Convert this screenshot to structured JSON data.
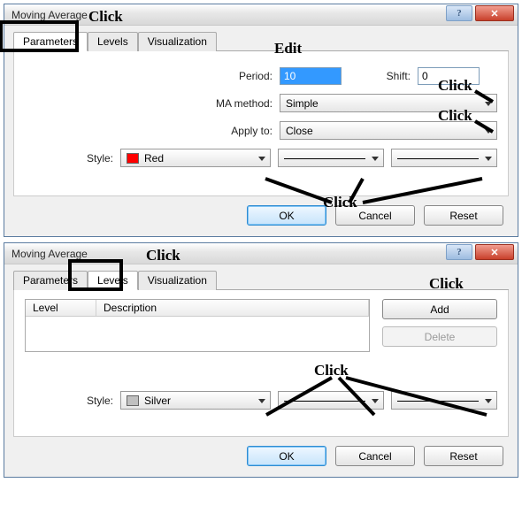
{
  "dialog1": {
    "title": "Moving Average",
    "tabs": {
      "parameters": "Parameters",
      "levels": "Levels",
      "visualization": "Visualization"
    },
    "period_label": "Period:",
    "period_value": "10",
    "shift_label": "Shift:",
    "shift_value": "0",
    "ma_method_label": "MA method:",
    "ma_method_value": "Simple",
    "apply_to_label": "Apply to:",
    "apply_to_value": "Close",
    "style_label": "Style:",
    "style_color_name": "Red",
    "style_color_hex": "#ff0000",
    "buttons": {
      "ok": "OK",
      "cancel": "Cancel",
      "reset": "Reset"
    },
    "annotations": {
      "click_tab": "Click",
      "edit": "Edit",
      "click_ma": "Click",
      "click_apply": "Click",
      "click_styles": "Click"
    }
  },
  "dialog2": {
    "title": "Moving Average",
    "tabs": {
      "parameters": "Parameters",
      "levels": "Levels",
      "visualization": "Visualization"
    },
    "list_headers": {
      "level": "Level",
      "description": "Description"
    },
    "add_label": "Add",
    "delete_label": "Delete",
    "style_label": "Style:",
    "style_color_name": "Silver",
    "style_color_hex": "#c0c0c0",
    "buttons": {
      "ok": "OK",
      "cancel": "Cancel",
      "reset": "Reset"
    },
    "annotations": {
      "click_tab": "Click",
      "click_add": "Click",
      "click_styles": "Click"
    }
  }
}
